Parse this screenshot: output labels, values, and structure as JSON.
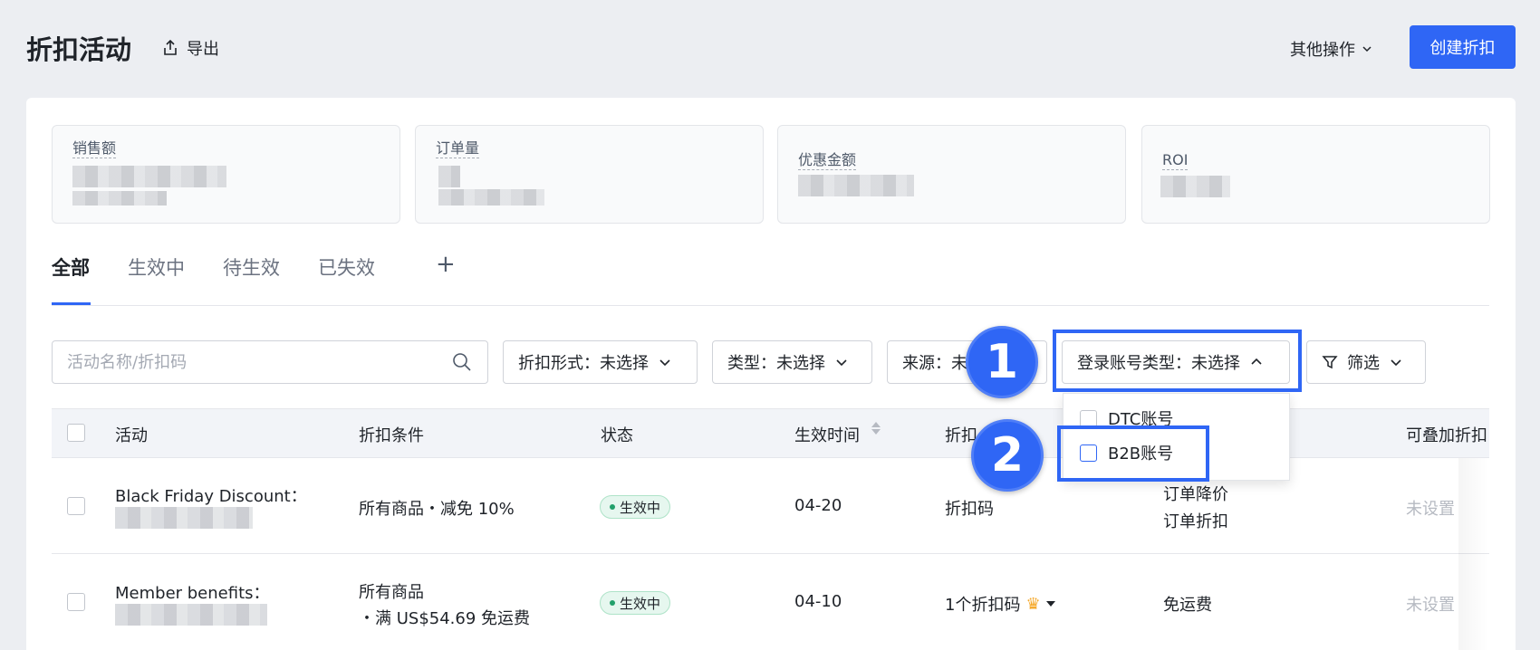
{
  "header": {
    "title": "折扣活动",
    "export_label": "导出",
    "other_ops_label": "其他操作",
    "create_label": "创建折扣"
  },
  "stats": [
    {
      "label": "销售额"
    },
    {
      "label": "订单量"
    },
    {
      "label": "优惠金额"
    },
    {
      "label": "ROI"
    }
  ],
  "tabs": [
    {
      "label": "全部",
      "active": true
    },
    {
      "label": "生效中"
    },
    {
      "label": "待生效"
    },
    {
      "label": "已失效"
    }
  ],
  "search": {
    "placeholder": "活动名称/折扣码"
  },
  "filters": {
    "discount_form": "折扣形式：未选择",
    "type": "类型：未选择",
    "source": "来源：未选择",
    "login_account_type": "登录账号类型：未选择",
    "screen": "筛选"
  },
  "dropdown": {
    "options": [
      "DTC账号",
      "B2B账号"
    ]
  },
  "annotations": {
    "step1": "1",
    "step2": "2"
  },
  "table": {
    "columns": [
      "活动",
      "折扣条件",
      "状态",
      "生效时间",
      "折扣",
      "",
      "可叠加折扣"
    ],
    "rows": [
      {
        "activity": "Black Friday Discount：",
        "condition_line1": "所有商品・减免 10%",
        "condition_line2": "",
        "status": "生效中",
        "effective_time": "04-20",
        "discount": "折扣码",
        "type_line1": "订单降价",
        "type_line2": "订单折扣",
        "stackable": "未设置"
      },
      {
        "activity": "Member benefits：",
        "condition_line1": "所有商品",
        "condition_line2": "・满 US$54.69 免运费",
        "status": "生效中",
        "effective_time": "04-10",
        "discount": "1个折扣码",
        "type_line1": "免运费",
        "type_line2": "",
        "stackable": "未设置"
      }
    ]
  },
  "colors": {
    "primary": "#2f66f5",
    "status_green": "#22a06b",
    "background": "#eceef2"
  }
}
